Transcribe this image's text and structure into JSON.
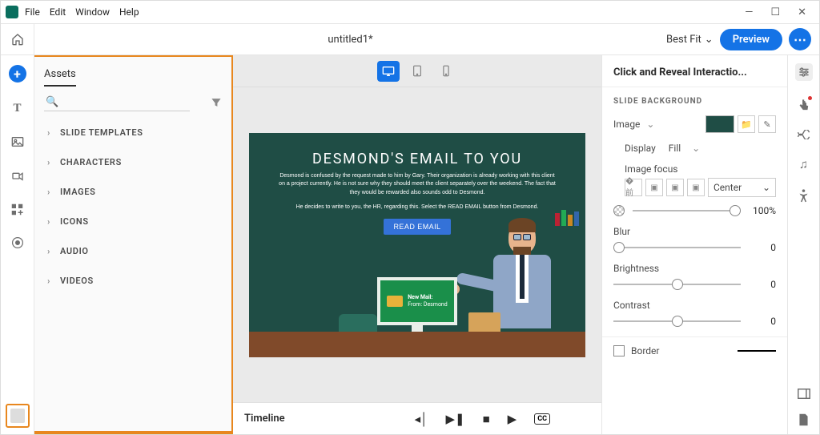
{
  "menubar": {
    "items": [
      "File",
      "Edit",
      "Window",
      "Help"
    ]
  },
  "title": "untitled1*",
  "zoom": "Best Fit",
  "preview_label": "Preview",
  "assets": {
    "tab": "Assets",
    "search_placeholder": "",
    "categories": [
      "SLIDE TEMPLATES",
      "CHARACTERS",
      "IMAGES",
      "ICONS",
      "AUDIO",
      "VIDEOS"
    ]
  },
  "slide": {
    "heading": "DESMOND'S EMAIL TO YOU",
    "para1": "Desmond is confused by the request made to him by Gary. Their organization is already working with this client on a project currently. He is not sure why they should meet the client separately over the weekend. The fact that they would be rewarded also sounds odd to Desmond.",
    "para2": "He decides to write to you, the HR, regarding this. Select the READ EMAIL button from Desmond.",
    "button": "READ EMAIL",
    "mail_line1": "New Mail:",
    "mail_line2": "From: Desmond"
  },
  "timeline": {
    "label": "Timeline",
    "cc": "CC"
  },
  "props": {
    "title": "Click and Reveal Interactio...",
    "section": "SLIDE BACKGROUND",
    "image_label": "Image",
    "display_label": "Display",
    "display_value": "Fill",
    "focus_label": "Image focus",
    "focus_value": "Center",
    "opacity_value": "100%",
    "blur_label": "Blur",
    "blur_value": "0",
    "brightness_label": "Brightness",
    "brightness_value": "0",
    "contrast_label": "Contrast",
    "contrast_value": "0",
    "border_label": "Border"
  }
}
